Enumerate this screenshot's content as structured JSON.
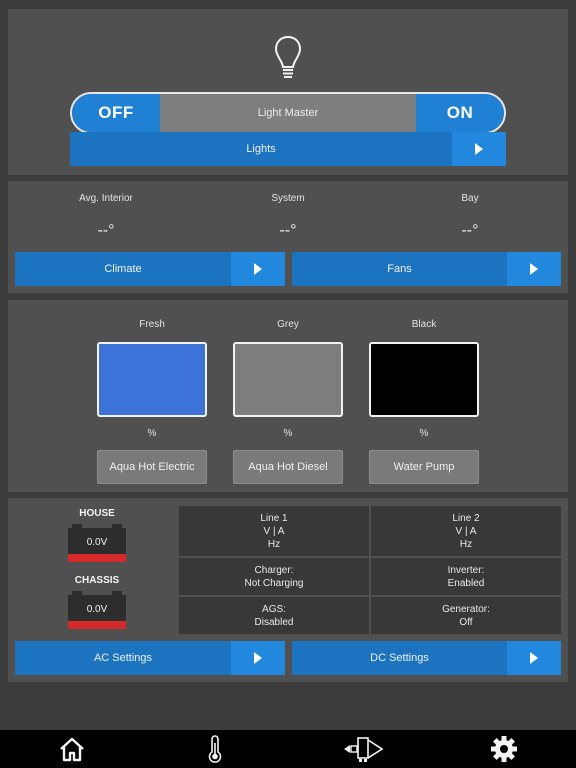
{
  "lights": {
    "toggle_off": "OFF",
    "toggle_label": "Light Master",
    "toggle_on": "ON",
    "nav_label": "Lights"
  },
  "climate": {
    "zones": [
      {
        "label": "Avg. Interior",
        "value": "--°"
      },
      {
        "label": "System",
        "value": "--°"
      },
      {
        "label": "Bay",
        "value": "--°"
      }
    ],
    "climate_btn": "Climate",
    "fans_btn": "Fans"
  },
  "tanks": {
    "items": [
      {
        "label": "Fresh",
        "percent": "%",
        "color": "#3d72d8"
      },
      {
        "label": "Grey",
        "percent": "%",
        "color": "#7d7d7d"
      },
      {
        "label": "Black",
        "percent": "%",
        "color": "#000000"
      }
    ],
    "buttons": [
      "Aqua Hot Electric",
      "Aqua Hot Diesel",
      "Water Pump"
    ]
  },
  "power": {
    "house": {
      "label": "HOUSE",
      "voltage": "0.0V"
    },
    "chassis": {
      "label": "CHASSIS",
      "voltage": "0.0V"
    },
    "line1": {
      "title": "Line 1",
      "va": "V | A",
      "hz": "Hz"
    },
    "line2": {
      "title": "Line 2",
      "va": "V | A",
      "hz": "Hz"
    },
    "charger": {
      "title": "Charger:",
      "value": "Not Charging"
    },
    "inverter": {
      "title": "Inverter:",
      "value": "Enabled"
    },
    "ags": {
      "title": "AGS:",
      "value": "Disabled"
    },
    "generator": {
      "title": "Generator:",
      "value": "Off"
    },
    "ac_btn": "AC Settings",
    "dc_btn": "DC Settings"
  },
  "colors": {
    "accent": "#1c74c0",
    "accent_light": "#2288de",
    "battery_red": "#d42a2a"
  },
  "tabbar": {
    "icons": [
      "home-icon",
      "thermometer-icon",
      "slide-out-icon",
      "gear-icon"
    ]
  }
}
